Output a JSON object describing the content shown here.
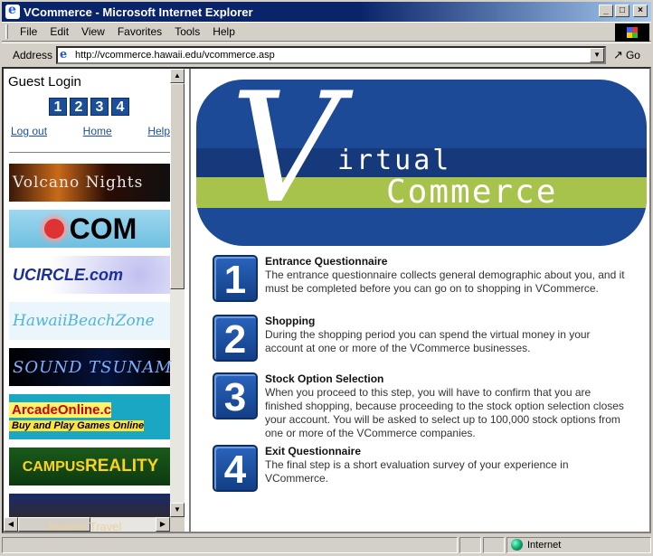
{
  "window": {
    "title": "VCommerce - Microsoft Internet Explorer",
    "buttons": [
      "_",
      "□",
      "×"
    ]
  },
  "menu": {
    "items": [
      "File",
      "Edit",
      "View",
      "Favorites",
      "Tools",
      "Help"
    ]
  },
  "address": {
    "label": "Address",
    "url": "http://vcommerce.hawaii.edu/vcommerce.asp",
    "go_label": "Go",
    "go_arrow": "↗"
  },
  "left": {
    "login_title": "Guest Login",
    "step_numbers": [
      "1",
      "2",
      "3",
      "4"
    ],
    "links": {
      "logout": "Log out",
      "home": "Home",
      "help": "Help"
    },
    "ads": {
      "volcano": "Volcano Nights",
      "com": "COM",
      "ucircle": "UCIRCLE.com",
      "hawaii": "HawaiiBeachZone",
      "tsunami": "SOUND TSUNAMI",
      "arcade_line1": "ArcadeOnline.c",
      "arcade_line2": "Buy and Play Games Online",
      "campus_small": "CAMPUS",
      "campus_big": "REALITY",
      "travel": "Auction Travel"
    }
  },
  "banner": {
    "letter": "V",
    "word1": "irtual",
    "word2": "Commerce"
  },
  "steps": [
    {
      "number": "1",
      "title": "Entrance Questionnaire",
      "text": "The entrance questionnaire collects general demographic about you, and it must be completed before you can go on to shopping in VCommerce."
    },
    {
      "number": "2",
      "title": "Shopping",
      "text": "During the shopping period you can spend the virtual money in your account at one or more of the VCommerce businesses."
    },
    {
      "number": "3",
      "title": "Stock Option Selection",
      "text": "When you proceed to this step, you will have to confirm that you are finished shopping, because proceeding to the stock option selection closes your account. You will be asked to select up to 100,000 stock options from one or more of the VCommerce companies."
    },
    {
      "number": "4",
      "title": "Exit Questionnaire",
      "text": "The final step is a short evaluation survey of your experience in VCommerce."
    }
  ],
  "statusbar": {
    "zone": "Internet"
  }
}
